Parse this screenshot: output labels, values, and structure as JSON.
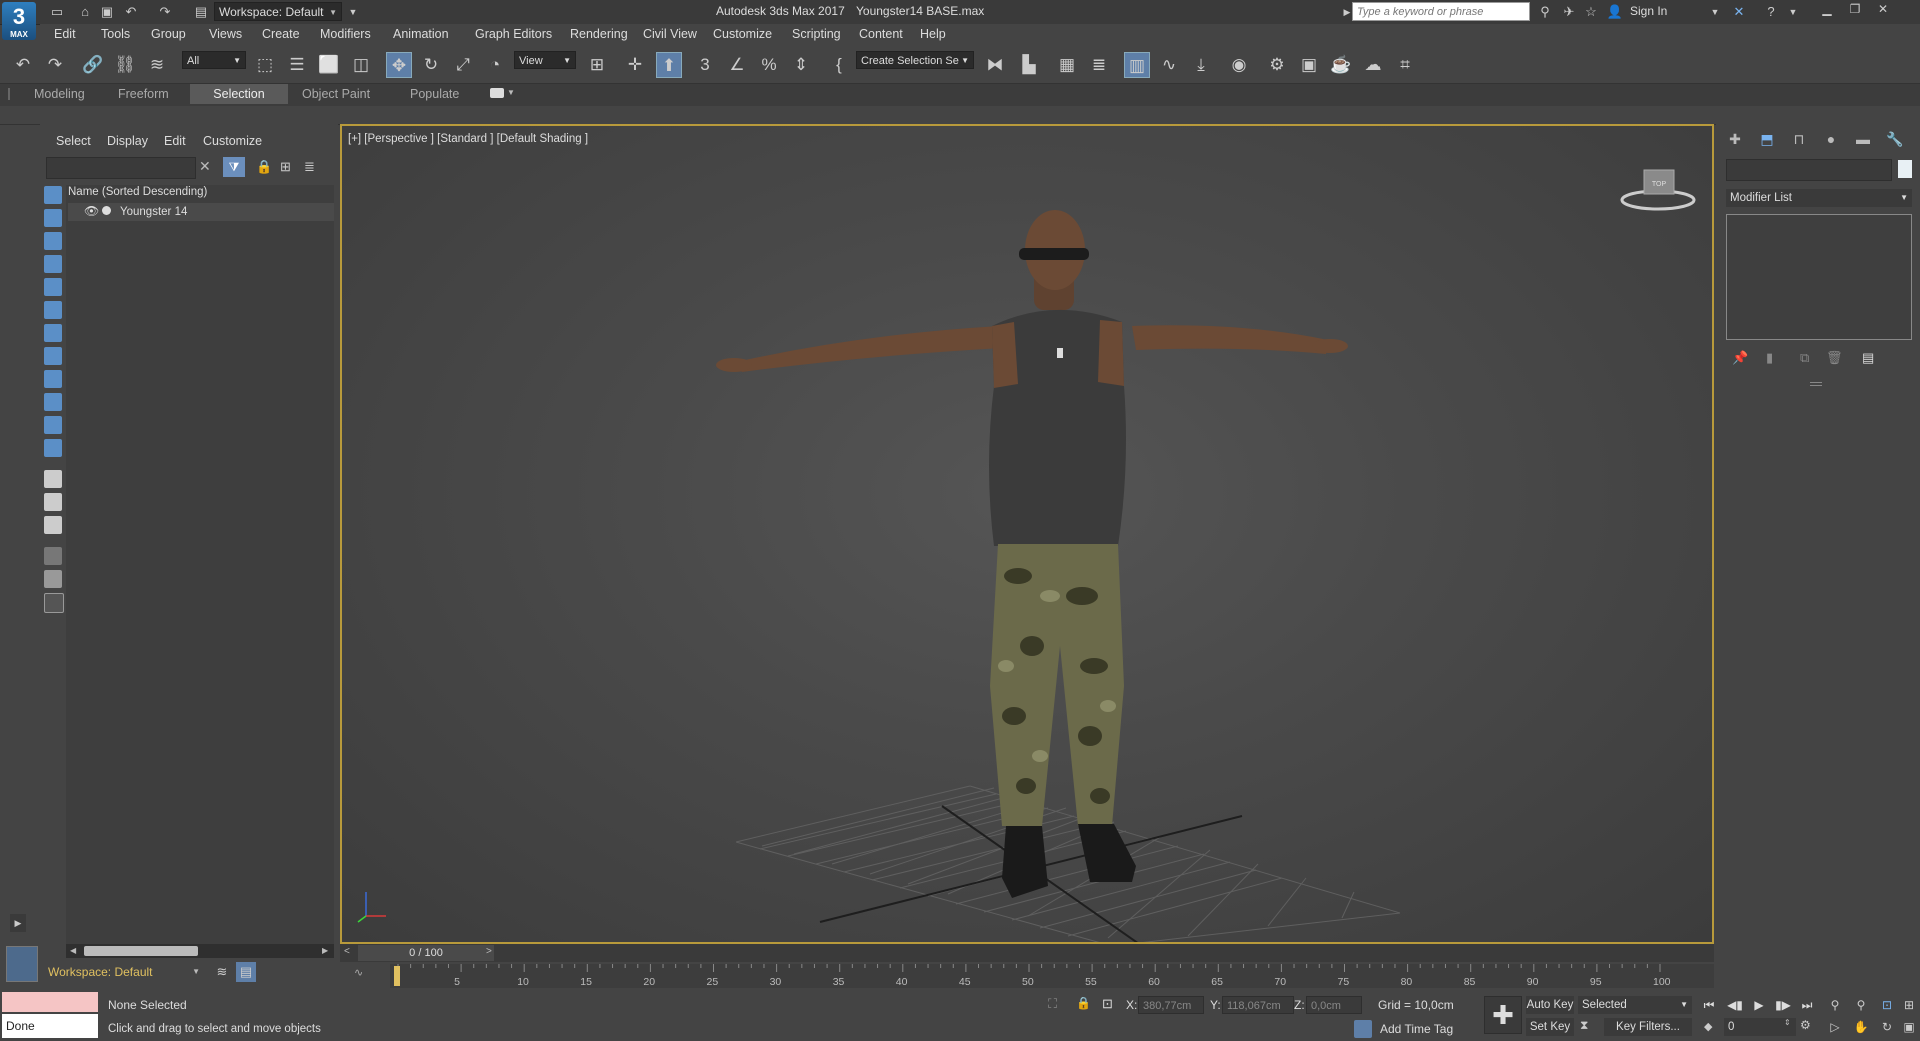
{
  "titlebar": {
    "logo_text": "3",
    "logo_sub": "MAX",
    "workspace_select": "Workspace: Default",
    "app_title": "Autodesk 3ds Max 2017",
    "file_title": "Youngster14 BASE.max",
    "search_placeholder": "Type a keyword or phrase",
    "signin_label": "Sign In"
  },
  "menus": [
    "Edit",
    "Tools",
    "Group",
    "Views",
    "Create",
    "Modifiers",
    "Animation",
    "Graph Editors",
    "Rendering",
    "Civil View",
    "Customize",
    "Scripting",
    "Content",
    "Help"
  ],
  "toolbar": {
    "filter_select": "All",
    "refcoord_select": "View",
    "selection_set": "Create Selection Se"
  },
  "ribbon_tabs": [
    "Modeling",
    "Freeform",
    "Selection",
    "Object Paint",
    "Populate"
  ],
  "ribbon_active": "Selection",
  "scene_explorer": {
    "menus": [
      "Select",
      "Display",
      "Edit",
      "Customize"
    ],
    "column_header": "Name (Sorted Descending)",
    "rows": [
      {
        "name": "Youngster 14"
      }
    ],
    "workspace": "Workspace: Default"
  },
  "viewport": {
    "label": "[+] [Perspective ] [Standard ] [Default Shading ]",
    "viewcube_text": "TOP",
    "colors": {
      "border_active": "#b89a3b",
      "skin": "#6b4a35",
      "tank_top": "#3b3b3b",
      "camo_base": "#6b6a4a"
    }
  },
  "time_slider": {
    "position": "0 / 100",
    "ticks": [
      "5",
      "10",
      "15",
      "20",
      "25",
      "30",
      "35",
      "40",
      "45",
      "50",
      "55",
      "60",
      "65",
      "70",
      "75",
      "80",
      "85",
      "90",
      "95",
      "100"
    ]
  },
  "command_panel": {
    "modifier_list": "Modifier List"
  },
  "status": {
    "done": "Done",
    "selection": "None Selected",
    "prompt": "Click and drag to select and move objects",
    "x_label": "X:",
    "x_value": "380,77cm",
    "y_label": "Y:",
    "y_value": "118,067cm",
    "z_label": "Z:",
    "z_value": "0,0cm",
    "grid": "Grid = 10,0cm",
    "add_time_tag": "Add Time Tag",
    "auto_key": "Auto Key",
    "set_key": "Set Key",
    "selected_dropdown": "Selected",
    "key_filters": "Key Filters...",
    "frame": "0"
  }
}
